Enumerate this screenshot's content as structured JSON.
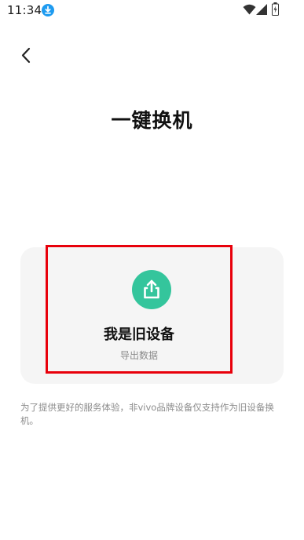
{
  "status_bar": {
    "time": "11:34",
    "icons": [
      "download-icon",
      "wifi-icon",
      "signal-icon",
      "battery-icon"
    ]
  },
  "header": {
    "back_icon": "chevron-left-icon"
  },
  "title": "一键换机",
  "card": {
    "icon": "export-icon",
    "title": "我是旧设备",
    "subtitle": "导出数据",
    "icon_color": "#34c59c",
    "highlight_color": "#e8000b"
  },
  "note": "为了提供更好的服务体验，非vivo品牌设备仅支持作为旧设备换机。"
}
